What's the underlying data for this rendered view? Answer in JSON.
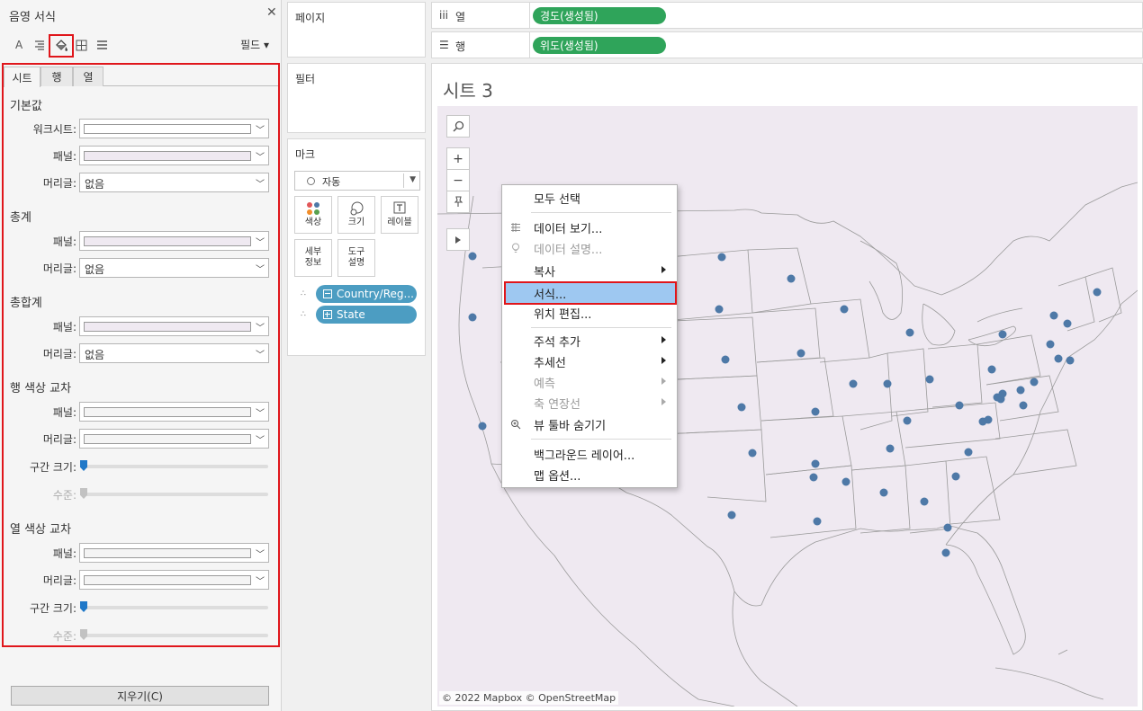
{
  "format_pane": {
    "title": "음영 서식",
    "toolbar": {
      "font_icon_label": "A",
      "fields_label": "필드"
    },
    "tabs": [
      {
        "label": "시트"
      },
      {
        "label": "행"
      },
      {
        "label": "열"
      }
    ],
    "sections": {
      "default": {
        "title": "기본값",
        "worksheet_label": "워크시트:",
        "pane_label": "패널:",
        "header_label": "머리글:",
        "header_value": "없음"
      },
      "totals": {
        "title": "총계",
        "pane_label": "패널:",
        "header_label": "머리글:",
        "header_value": "없음"
      },
      "grand_totals": {
        "title": "총합계",
        "pane_label": "패널:",
        "header_label": "머리글:",
        "header_value": "없음"
      },
      "row_banding": {
        "title": "행 색상 교차",
        "pane_label": "패널:",
        "header_label": "머리글:",
        "band_size_label": "구간 크기:",
        "level_label": "수준:",
        "band_size_value": 0,
        "level_value": 0
      },
      "col_banding": {
        "title": "열 색상 교차",
        "pane_label": "패널:",
        "header_label": "머리글:",
        "band_size_label": "구간 크기:",
        "level_label": "수준:",
        "band_size_value": 0,
        "level_value": 0
      }
    },
    "clear_label": "지우기(C)"
  },
  "cards": {
    "pages": {
      "title": "페이지"
    },
    "filters": {
      "title": "필터"
    },
    "marks": {
      "title": "마크",
      "mark_type": "자동",
      "buttons": {
        "color": "색상",
        "size": "크기",
        "label": "레이블",
        "detail_1": "세부",
        "detail_2": "정보",
        "tooltip_1": "도구",
        "tooltip_2": "설명"
      },
      "pills": [
        {
          "label": "Country/Reg..."
        },
        {
          "label": "State"
        }
      ]
    }
  },
  "shelves": {
    "columns": {
      "label": "열",
      "pill": "경도(생성됨)"
    },
    "rows": {
      "label": "행",
      "pill": "위도(생성됨)"
    }
  },
  "viz": {
    "sheet_title": "시트 3",
    "attribution": "© 2022 Mapbox © OpenStreetMap"
  },
  "context_menu": {
    "items": {
      "select_all": "모두 선택",
      "view_data": "데이터 보기...",
      "describe_data": "데이터 설명...",
      "copy": "복사",
      "format": "서식...",
      "edit_locations": "위치 편집...",
      "annotate": "주석 추가",
      "trend_lines": "추세선",
      "forecast": "예측",
      "axis_extension": "축 연장선",
      "hide_view_toolbar": "뷰 툴바 숨기기",
      "background_layers": "백그라운드 레이어...",
      "map_options": "맵 옵션..."
    }
  },
  "colors": {
    "accent_red": "#e0161b",
    "green_pill": "#2fa45a",
    "blue_pill": "#4c9dc2",
    "highlight": "#9ec8f1",
    "map_bg": "#efe9f1",
    "point": "#4e79a7"
  }
}
